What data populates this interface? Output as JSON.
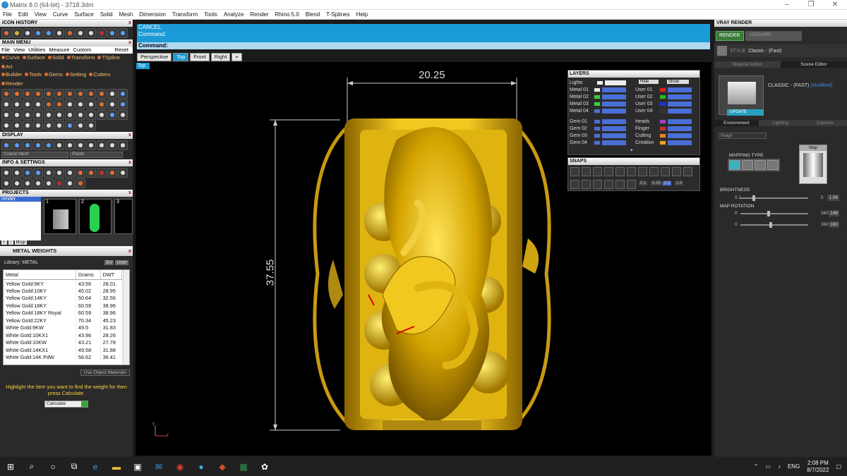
{
  "window": {
    "title": "Matrix 8.0 (64-bit) - 3718.3dm"
  },
  "menubar": [
    "File",
    "Edit",
    "View",
    "Curve",
    "Surface",
    "Solid",
    "Mesh",
    "Dimension",
    "Transform",
    "Tools",
    "Analyze",
    "Render",
    "Rhino 5.0",
    "Blend",
    "T-Splines",
    "Help"
  ],
  "left": {
    "icon_history": "ICON HISTORY",
    "main_menu": "MAIN MENU",
    "main_menu_items": [
      "File",
      "View",
      "Utilities",
      "Measure",
      "Custom"
    ],
    "reset": "Reset",
    "submenu_row1": [
      "Curve",
      "Surface",
      "Solid",
      "Transform",
      "TSpline",
      "Art"
    ],
    "submenu_row2": [
      "Builder",
      "Tools",
      "Gems",
      "Setting",
      "Cutters",
      "Render"
    ],
    "display": "DISPLAY",
    "display_mode": "Coarse Mesh",
    "display_material": "Plastic",
    "info_settings": "INFO & SETTINGS",
    "projects": "PROJECTS",
    "project_item": "render",
    "thumb_nums": [
      "1",
      "2",
      "3"
    ],
    "mngr": "Mngr",
    "metal_weights": "METAL WEIGHTS",
    "library": "Library: METAL",
    "sv": "SV",
    "user": "User",
    "cols": [
      "Metal",
      "Grams",
      "DWT"
    ],
    "rows": [
      [
        "Yellow Gold:9KY",
        "43.56",
        "28.01"
      ],
      [
        "Yellow Gold:10KY",
        "45.02",
        "28.95"
      ],
      [
        "Yellow Gold:14KY",
        "50.64",
        "32.56"
      ],
      [
        "Yellow Gold:18KY",
        "60.59",
        "38.96"
      ],
      [
        "Yellow Gold:18KY Royal",
        "60.59",
        "38.96"
      ],
      [
        "Yellow Gold:22KY",
        "70.34",
        "45.23"
      ],
      [
        "White Gold:9KW",
        "49.5",
        "31.83"
      ],
      [
        "White Gold:10KX1",
        "43.96",
        "28.26"
      ],
      [
        "White Gold:10KW",
        "43.21",
        "27.78"
      ],
      [
        "White Gold:14KX1",
        "49.58",
        "31.88"
      ],
      [
        "White Gold:14K PdW",
        "56.62",
        "36.41"
      ]
    ],
    "use_object_materials": "Use Object Materials",
    "hint": "Highlight the item you want to find the weight for then press Calculate.",
    "calculate": "Calculate"
  },
  "command": {
    "cancel": "CANCEL",
    "line1": "Command:",
    "prompt": "Command:"
  },
  "tabs": [
    "Perspective",
    "Top",
    "Front",
    "Right"
  ],
  "viewport": {
    "label": "Top",
    "dim_width": "20.25",
    "dim_height": "37.55",
    "axis_y": "y",
    "axis_x": "x"
  },
  "layers": {
    "title": "LAYERS",
    "lights": "Lights",
    "hide": "Hide",
    "show": "Show",
    "left": [
      {
        "name": "Metal 01",
        "color": "#e8e8e8"
      },
      {
        "name": "Metal 02",
        "color": "#3ad040"
      },
      {
        "name": "Metal 03",
        "color": "#3ad040"
      },
      {
        "name": "Metal 04",
        "color": "#4a6ed8"
      },
      {
        "name": "Gem 01",
        "color": "#4a6ed8"
      },
      {
        "name": "Gem 02",
        "color": "#4a6ed8"
      },
      {
        "name": "Gem 03",
        "color": "#4a6ed8"
      },
      {
        "name": "Gem 04",
        "color": "#4a6ed8"
      }
    ],
    "right": [
      {
        "name": "User 01",
        "color": "#e02020"
      },
      {
        "name": "User 02",
        "color": "#20c020"
      },
      {
        "name": "User 03",
        "color": "#2030e0"
      },
      {
        "name": "User 04",
        "color": "#333333"
      },
      {
        "name": "Heads",
        "color": "#a040c0"
      },
      {
        "name": "Finger",
        "color": "#d03030"
      },
      {
        "name": "Cutting",
        "color": "#f08020"
      },
      {
        "name": "Creation",
        "color": "#f0a020"
      }
    ]
  },
  "snaps": {
    "title": "SNAPS",
    "values": [
      "0.1",
      "0.25",
      "0.5",
      "1.0"
    ]
  },
  "right": {
    "title": "VRAY RENDER",
    "render": "RENDER",
    "resolution": "1200x900",
    "style_label": "STYLE",
    "style": "Classic - (Fast)",
    "editor_tabs": [
      "Material Editor",
      "Scene Editor"
    ],
    "preset": "CLASSIC - (FAST)",
    "modified": "(Modified)",
    "update": "UPDATE",
    "env_tabs": [
      "Environment",
      "Lighting",
      "Camera"
    ],
    "image": "Image",
    "mapping_type": "MAPPING TYPE",
    "map": "Map",
    "brightness": "BRIGHTNESS",
    "brightness_min": "0.1",
    "brightness_max": "5",
    "brightness_val": "1.06",
    "brightness_frac": 0.2,
    "map_rotation": "MAP ROTATION",
    "rot_min1": "0",
    "rot_max1": "360",
    "rot_val1": "149",
    "rot_frac1": 0.414,
    "rot_min2": "0",
    "rot_max2": "360",
    "rot_val2": "160",
    "rot_frac2": 0.444
  },
  "taskbar": {
    "lang": "ENG",
    "time": "2:08 PM",
    "date": "8/7/2022"
  },
  "colors": {
    "accent": "#1a9ad6",
    "gold": "#d4a800"
  }
}
